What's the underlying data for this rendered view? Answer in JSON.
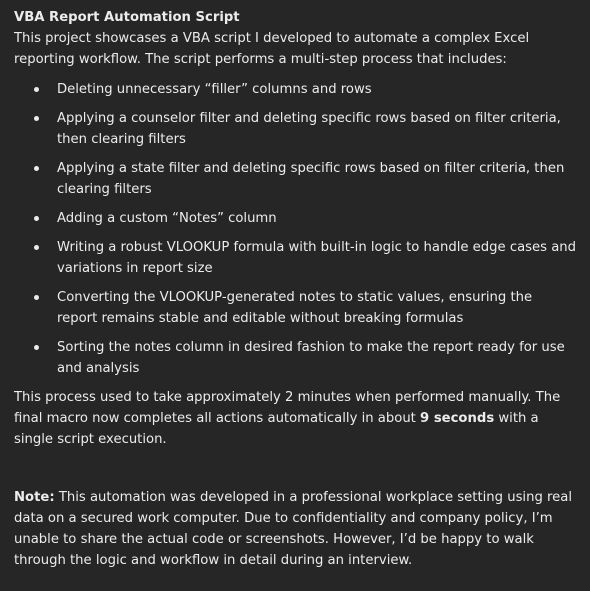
{
  "doc": {
    "title": "VBA Report Automation Script",
    "intro": "This project showcases a VBA script I developed to automate a complex Excel reporting workflow. The script performs a multi-step process that includes:",
    "steps": [
      "Deleting unnecessary “filler” columns and rows",
      "Applying a counselor filter and deleting specific rows based on filter criteria, then clearing filters",
      "Applying a state filter and deleting specific rows based on filter criteria, then clearing filters",
      "Adding a custom “Notes” column",
      "Writing a robust VLOOKUP formula with built-in logic to handle edge cases and variations in report size",
      "Converting the VLOOKUP-generated notes to static values, ensuring the report remains stable and editable without breaking formulas",
      "Sorting the notes column in desired fashion to make the report ready for use and analysis"
    ],
    "result": {
      "before": "This process used to take approximately 2 minutes when performed manually. The final macro now completes all actions automatically in about ",
      "highlight": "9 seconds",
      "after": " with a single script execution."
    },
    "note": {
      "label": "Note:",
      "text": " This automation was developed in a professional workplace setting using real data on a secured work computer. Due to confidentiality and company policy, I’m unable to share the actual code or screenshots. However, I’d be happy to walk through the logic and workflow in detail during an interview."
    }
  }
}
